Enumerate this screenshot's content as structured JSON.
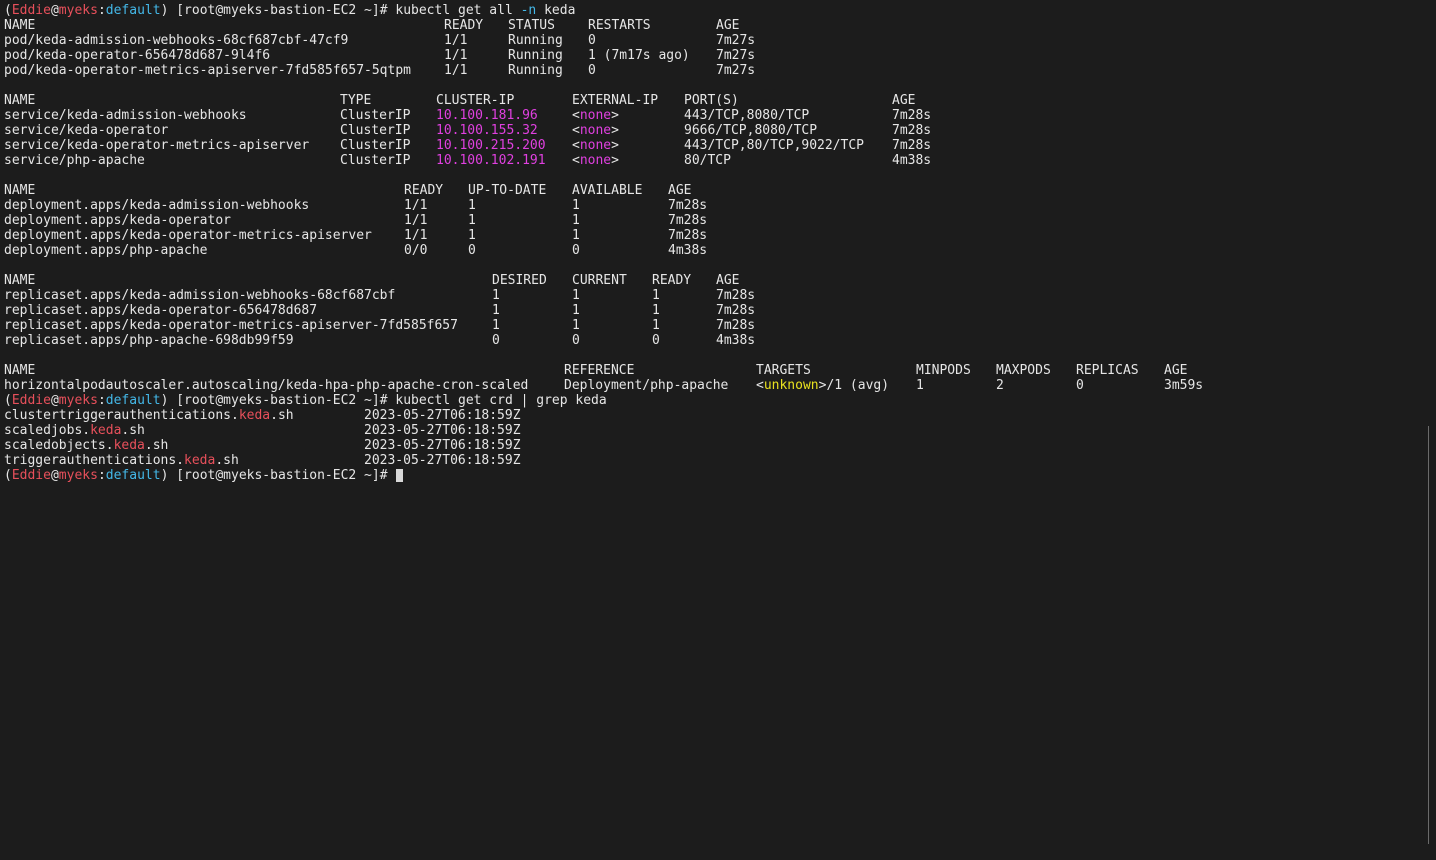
{
  "prompt": {
    "user": "Eddie",
    "host": "myeks",
    "ctx": "default",
    "shell": "[root@myeks-bastion-EC2 ~]#"
  },
  "cmd1": {
    "text": "kubectl get all",
    "flag": "-n",
    "arg": "keda"
  },
  "cmd2": {
    "text": "kubectl get crd | grep keda"
  },
  "pods": {
    "headers": [
      "NAME",
      "READY",
      "STATUS",
      "RESTARTS",
      "AGE"
    ],
    "rows": [
      [
        "pod/keda-admission-webhooks-68cf687cbf-47cf9",
        "1/1",
        "Running",
        "0",
        "7m27s"
      ],
      [
        "pod/keda-operator-656478d687-9l4f6",
        "1/1",
        "Running",
        "1 (7m17s ago)",
        "7m27s"
      ],
      [
        "pod/keda-operator-metrics-apiserver-7fd585f657-5qtpm",
        "1/1",
        "Running",
        "0",
        "7m27s"
      ]
    ]
  },
  "services": {
    "headers": [
      "NAME",
      "TYPE",
      "CLUSTER-IP",
      "EXTERNAL-IP",
      "PORT(S)",
      "AGE"
    ],
    "rows": [
      [
        "service/keda-admission-webhooks",
        "ClusterIP",
        "10.100.181.96",
        "<",
        "none",
        ">",
        "443/TCP,8080/TCP",
        "7m28s"
      ],
      [
        "service/keda-operator",
        "ClusterIP",
        "10.100.155.32",
        "<",
        "none",
        ">",
        "9666/TCP,8080/TCP",
        "7m28s"
      ],
      [
        "service/keda-operator-metrics-apiserver",
        "ClusterIP",
        "10.100.215.200",
        "<",
        "none",
        ">",
        "443/TCP,80/TCP,9022/TCP",
        "7m28s"
      ],
      [
        "service/php-apache",
        "ClusterIP",
        "10.100.102.191",
        "<",
        "none",
        ">",
        "80/TCP",
        "4m38s"
      ]
    ]
  },
  "deployments": {
    "headers": [
      "NAME",
      "READY",
      "UP-TO-DATE",
      "AVAILABLE",
      "AGE"
    ],
    "rows": [
      [
        "deployment.apps/keda-admission-webhooks",
        "1/1",
        "1",
        "1",
        "7m28s"
      ],
      [
        "deployment.apps/keda-operator",
        "1/1",
        "1",
        "1",
        "7m28s"
      ],
      [
        "deployment.apps/keda-operator-metrics-apiserver",
        "1/1",
        "1",
        "1",
        "7m28s"
      ],
      [
        "deployment.apps/php-apache",
        "0/0",
        "0",
        "0",
        "4m38s"
      ]
    ]
  },
  "replicasets": {
    "headers": [
      "NAME",
      "DESIRED",
      "CURRENT",
      "READY",
      "AGE"
    ],
    "rows": [
      [
        "replicaset.apps/keda-admission-webhooks-68cf687cbf",
        "1",
        "1",
        "1",
        "7m28s"
      ],
      [
        "replicaset.apps/keda-operator-656478d687",
        "1",
        "1",
        "1",
        "7m28s"
      ],
      [
        "replicaset.apps/keda-operator-metrics-apiserver-7fd585f657",
        "1",
        "1",
        "1",
        "7m28s"
      ],
      [
        "replicaset.apps/php-apache-698db99f59",
        "0",
        "0",
        "0",
        "4m38s"
      ]
    ]
  },
  "hpa": {
    "headers": [
      "NAME",
      "REFERENCE",
      "TARGETS",
      "MINPODS",
      "MAXPODS",
      "REPLICAS",
      "AGE"
    ],
    "row": [
      "horizontalpodautoscaler.autoscaling/keda-hpa-php-apache-cron-scaled",
      "Deployment/php-apache",
      "<",
      "unknown",
      ">/1 (avg)",
      "1",
      "2",
      "0",
      "3m59s"
    ]
  },
  "crds": {
    "rows": [
      [
        "clustertriggerauthentications.",
        "keda",
        ".sh",
        "2023-05-27T06:18:59Z"
      ],
      [
        "scaledjobs.",
        "keda",
        ".sh",
        "2023-05-27T06:18:59Z"
      ],
      [
        "scaledobjects.",
        "keda",
        ".sh",
        "2023-05-27T06:18:59Z"
      ],
      [
        "triggerauthentications.",
        "keda",
        ".sh",
        "2023-05-27T06:18:59Z"
      ]
    ]
  },
  "colors": {
    "background": "#1c1c1c",
    "text": "#e6e6e6",
    "user": "#e8505b",
    "context": "#44b8e8",
    "ip": "#e040e0",
    "unknown": "#e8e020"
  }
}
